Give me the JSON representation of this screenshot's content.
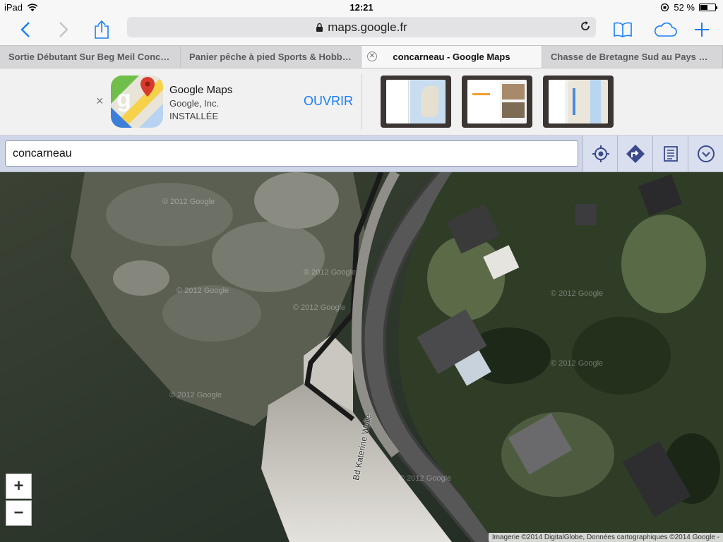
{
  "status_bar": {
    "device": "iPad",
    "time": "12:21",
    "battery": "52 %",
    "battery_level": 0.52
  },
  "browser": {
    "url": "maps.google.fr",
    "tabs": [
      {
        "label": "Sortie Débutant Sur Beg Meil Concarn...",
        "active": false
      },
      {
        "label": "Panier pêche à pied Sports & Hobbies...",
        "active": false
      },
      {
        "label": "concarneau - Google Maps",
        "active": true
      },
      {
        "label": "Chasse de Bretagne Sud au Pays Bas...",
        "active": false
      }
    ]
  },
  "app_banner": {
    "close": "×",
    "app_name": "Google Maps",
    "company": "Google, Inc.",
    "status": "INSTALLÉE",
    "open_label": "OUVRIR"
  },
  "maps": {
    "search_value": "concarneau",
    "street_label": "Bd Katerine Wylie",
    "zoom_in": "+",
    "zoom_out": "−",
    "attribution": "Imagerie ©2014 DigitalGlobe, Données cartographiques ©2014 Google -",
    "watermark": "© 2012 Google"
  },
  "colors": {
    "accent": "#1a7ff5",
    "maps_toolbar": "#cfd6e8"
  }
}
